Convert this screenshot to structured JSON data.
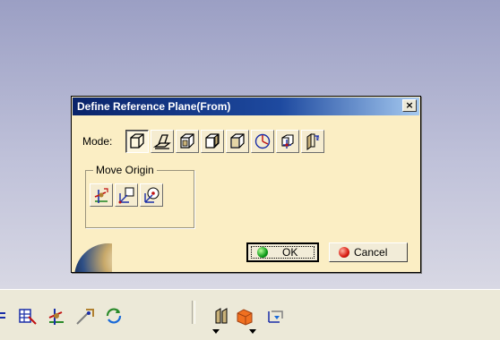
{
  "dialog": {
    "title": "Define Reference Plane(From)",
    "close_label": "×",
    "mode_label": "Mode:",
    "mode_buttons": [
      {
        "icon": "plane-cube-icon",
        "selected": true
      },
      {
        "icon": "plane-angle-icon"
      },
      {
        "icon": "plane-offset-icon"
      },
      {
        "icon": "plane-parallel-icon"
      },
      {
        "icon": "plane-normal-icon"
      },
      {
        "icon": "plane-circle-icon"
      },
      {
        "icon": "plane-point-icon"
      },
      {
        "icon": "plane-through-icon"
      }
    ],
    "move_origin": {
      "legend": "Move Origin",
      "buttons": [
        {
          "icon": "axis-origin-icon"
        },
        {
          "icon": "axis-plane-icon"
        },
        {
          "icon": "axis-point-icon"
        }
      ]
    },
    "ok_label": "OK",
    "cancel_label": "Cancel"
  },
  "colors": {
    "dialog_bg": "#fbeec4",
    "title_start": "#0a246a",
    "title_end": "#a6caf0",
    "ok_green": "#0d9a18",
    "cancel_red": "#d81a10"
  }
}
